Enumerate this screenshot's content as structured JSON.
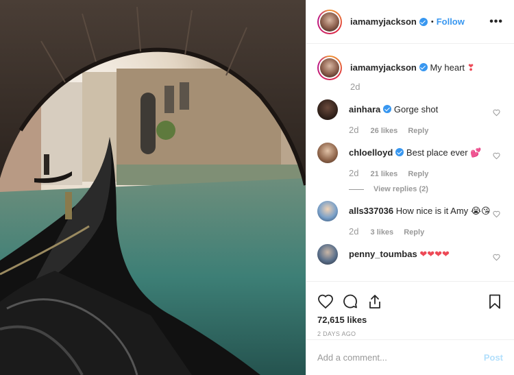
{
  "post": {
    "author": "iamamyjackson",
    "follow_label": "Follow",
    "dot": "•",
    "more_label": "•••",
    "caption": "My heart",
    "caption_emoji": "❣",
    "caption_time": "2d"
  },
  "comments": [
    {
      "user": "ainhara",
      "verified": true,
      "text": "Gorge shot",
      "emoji": "",
      "time": "2d",
      "likes": "26 likes",
      "reply": "Reply"
    },
    {
      "user": "chloelloyd",
      "verified": true,
      "text": "Best place ever",
      "emoji": "💕",
      "time": "2d",
      "likes": "21 likes",
      "reply": "Reply",
      "view_replies": "View replies (2)"
    },
    {
      "user": "alls337036",
      "verified": false,
      "text": "How nice is it Amy",
      "emoji": "😭😘",
      "time": "2d",
      "likes": "3 likes",
      "reply": "Reply"
    },
    {
      "user": "penny_toumbas",
      "verified": false,
      "text": "",
      "emoji": "❤❤❤❤",
      "time": "",
      "likes": "",
      "reply": ""
    }
  ],
  "actions": {
    "likes": "72,615 likes",
    "date": "2 DAYS AGO",
    "add_comment_placeholder": "Add a comment...",
    "post_label": "Post"
  },
  "icons": {
    "like": "heart-outline-icon",
    "comment": "comment-bubble-icon",
    "share": "share-upload-icon",
    "save": "bookmark-icon",
    "comment_like": "heart-small-icon"
  },
  "colors": {
    "accent": "#3897f0",
    "muted": "#999999",
    "heart": "#ed4956",
    "post_disabled": "#b2dffc"
  }
}
